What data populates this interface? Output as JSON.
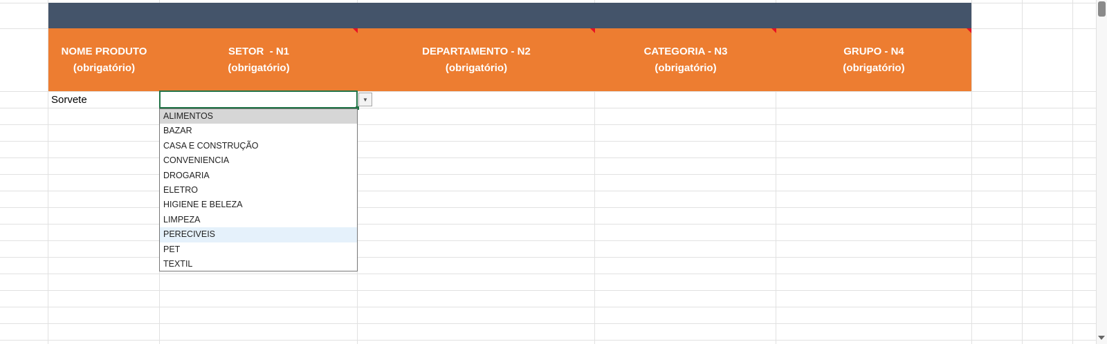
{
  "colors": {
    "header_dark": "#44546a",
    "header_orange": "#ed7d31",
    "active_cell_border": "#217346",
    "comment_indicator": "#e81123"
  },
  "headers": [
    {
      "title": "NOME PRODUTO",
      "subtitle": "(obrigatório)",
      "has_comment": false
    },
    {
      "title": "SETOR  - N1",
      "subtitle": "(obrigatório)",
      "has_comment": true
    },
    {
      "title": "DEPARTAMENTO - N2",
      "subtitle": "(obrigatório)",
      "has_comment": true
    },
    {
      "title": "CATEGORIA - N3",
      "subtitle": "(obrigatório)",
      "has_comment": true
    },
    {
      "title": "GRUPO - N4",
      "subtitle": "(obrigatório)",
      "has_comment": true
    }
  ],
  "row1": {
    "nome_produto": "Sorvete",
    "setor": ""
  },
  "dropdown": {
    "icon": "chevron-down-icon",
    "options": [
      "ALIMENTOS",
      "BAZAR",
      "CASA E CONSTRUÇÃO",
      "CONVENIENCIA",
      "DROGARIA",
      "ELETRO",
      "HIGIENE E BELEZA",
      "LIMPEZA",
      "PERECIVEIS",
      "PET",
      "TEXTIL"
    ],
    "selected": "ALIMENTOS",
    "hovered": "PERECIVEIS"
  }
}
